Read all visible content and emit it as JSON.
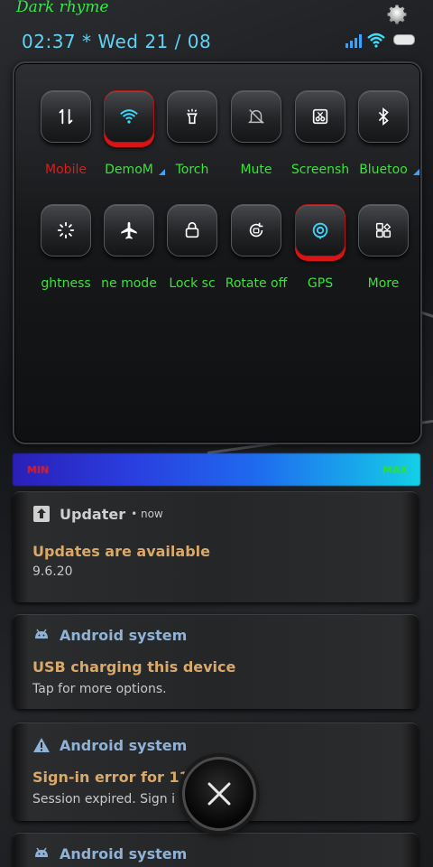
{
  "status_bar": {
    "theme_label": "Dark rhyme",
    "clock": "02:37 * Wed 21 / 08"
  },
  "quick_settings": {
    "tiles": [
      {
        "label": "Mobile",
        "icon": "mobile-data-icon",
        "active": false,
        "label_color": "#e21a1a"
      },
      {
        "label": "DemoM",
        "icon": "wifi-icon",
        "active": true,
        "label_color": "#3ae23a"
      },
      {
        "label": "Torch",
        "icon": "torch-icon",
        "active": false,
        "label_color": "#3ae23a"
      },
      {
        "label": "Mute",
        "icon": "mute-icon",
        "active": false,
        "label_color": "#3ae23a"
      },
      {
        "label": "Screensh",
        "icon": "screenshot-icon",
        "active": false,
        "label_color": "#3ae23a"
      },
      {
        "label": "Bluetoo",
        "icon": "bluetooth-icon",
        "active": false,
        "label_color": "#3ae23a"
      },
      {
        "label": "ghtness",
        "icon": "brightness-icon",
        "active": false,
        "label_color": "#3ae23a"
      },
      {
        "label": "ne mode",
        "icon": "airplane-icon",
        "active": false,
        "label_color": "#3ae23a"
      },
      {
        "label": "Lock sc",
        "icon": "lock-icon",
        "active": false,
        "label_color": "#3ae23a"
      },
      {
        "label": "Rotate off",
        "icon": "rotate-icon",
        "active": false,
        "label_color": "#3ae23a"
      },
      {
        "label": "GPS",
        "icon": "gps-icon",
        "active": true,
        "label_color": "#3ae23a"
      },
      {
        "label": "More",
        "icon": "more-icon",
        "active": false,
        "label_color": "#3ae23a"
      }
    ]
  },
  "brightness": {
    "min_label": "MIN",
    "max_label": "MAX"
  },
  "notifications": [
    {
      "app": "Updater",
      "time": "• now",
      "title": "Updates are available",
      "text": "9.6.20",
      "icon": "upload-icon"
    },
    {
      "app": "Android system",
      "time": "",
      "title": "USB charging this device",
      "text": "Tap for more options.",
      "icon": "android-icon"
    },
    {
      "app": "Android system",
      "time": "",
      "title": "Sign-in error for 11510",
      "text": "Session expired. Sign i",
      "icon": "warning-icon"
    },
    {
      "app": "Android system",
      "time": "",
      "title": "",
      "text": "",
      "icon": "android-icon"
    }
  ],
  "colors": {
    "accent_green": "#3ae23a",
    "accent_red": "#e21a1a",
    "clock_blue": "#5fd3f5",
    "notif_title": "#d9a96a"
  }
}
